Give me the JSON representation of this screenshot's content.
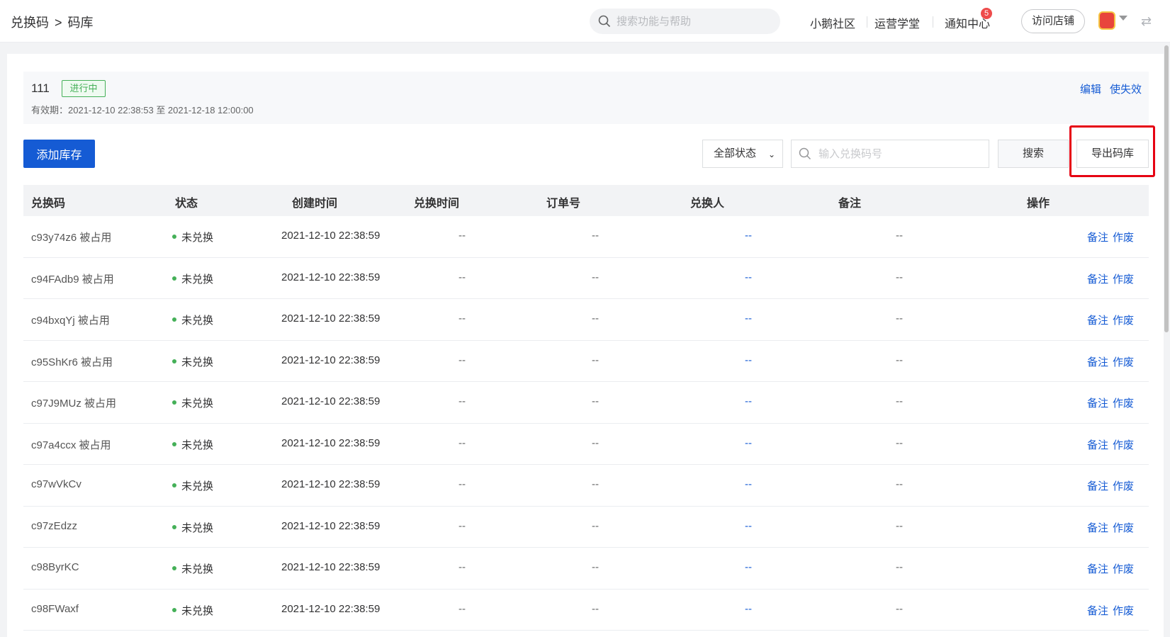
{
  "header": {
    "breadcrumb": [
      "兑换码",
      "码库"
    ],
    "breadcrumb_sep": ">",
    "search_placeholder": "搜索功能与帮助",
    "links": [
      "小鹅社区",
      "运营学堂",
      "通知中心"
    ],
    "notification_count": "5",
    "visit_store": "访问店铺"
  },
  "info": {
    "name": "111",
    "status": "进行中",
    "validity": "有效期：2021-12-10 22:38:53 至 2021-12-18 12:00:00",
    "edit": "编辑",
    "invalidate": "使失效"
  },
  "toolbar": {
    "add_stock": "添加库存",
    "status_filter": "全部状态",
    "code_placeholder": "输入兑换码号",
    "search": "搜索",
    "export": "导出码库"
  },
  "table": {
    "columns": [
      "兑换码",
      "状态",
      "创建时间",
      "兑换时间",
      "订单号",
      "兑换人",
      "备注",
      "操作"
    ],
    "rows": [
      {
        "code": "c93y74z6 被占用",
        "status": "未兑换",
        "created": "2021-12-10 22:38:59",
        "redeemed": "--",
        "order": "--",
        "person": "--",
        "note": "--"
      },
      {
        "code": "c94FAdb9 被占用",
        "status": "未兑换",
        "created": "2021-12-10 22:38:59",
        "redeemed": "--",
        "order": "--",
        "person": "--",
        "note": "--"
      },
      {
        "code": "c94bxqYj 被占用",
        "status": "未兑换",
        "created": "2021-12-10 22:38:59",
        "redeemed": "--",
        "order": "--",
        "person": "--",
        "note": "--"
      },
      {
        "code": "c95ShKr6 被占用",
        "status": "未兑换",
        "created": "2021-12-10 22:38:59",
        "redeemed": "--",
        "order": "--",
        "person": "--",
        "note": "--"
      },
      {
        "code": "c97J9MUz 被占用",
        "status": "未兑换",
        "created": "2021-12-10 22:38:59",
        "redeemed": "--",
        "order": "--",
        "person": "--",
        "note": "--"
      },
      {
        "code": "c97a4ccx 被占用",
        "status": "未兑换",
        "created": "2021-12-10 22:38:59",
        "redeemed": "--",
        "order": "--",
        "person": "--",
        "note": "--"
      },
      {
        "code": "c97wVkCv",
        "status": "未兑换",
        "created": "2021-12-10 22:38:59",
        "redeemed": "--",
        "order": "--",
        "person": "--",
        "note": "--"
      },
      {
        "code": "c97zEdzz",
        "status": "未兑换",
        "created": "2021-12-10 22:38:59",
        "redeemed": "--",
        "order": "--",
        "person": "--",
        "note": "--"
      },
      {
        "code": "c98ByrKC",
        "status": "未兑换",
        "created": "2021-12-10 22:38:59",
        "redeemed": "--",
        "order": "--",
        "person": "--",
        "note": "--"
      },
      {
        "code": "c98FWaxf",
        "status": "未兑换",
        "created": "2021-12-10 22:38:59",
        "redeemed": "--",
        "order": "--",
        "person": "--",
        "note": "--"
      }
    ],
    "actions": [
      "备注",
      "作废"
    ]
  },
  "colors": {
    "primary": "#155bd4",
    "success": "#45b058",
    "highlight": "#e60012"
  }
}
